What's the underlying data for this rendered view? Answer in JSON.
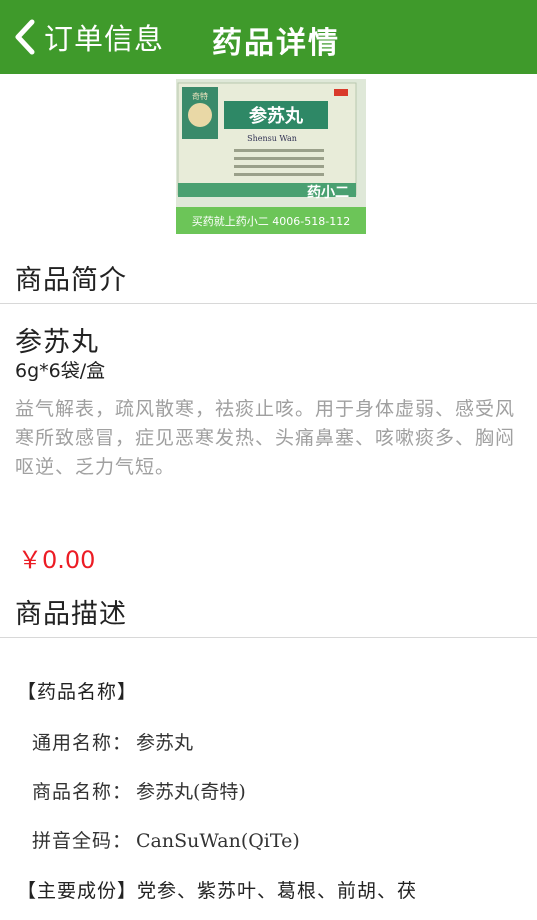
{
  "nav": {
    "back_label": "订单信息",
    "title": "药品详情"
  },
  "product": {
    "box": {
      "brand": "奇特",
      "name": "参苏丸",
      "pinyin": "Shensu Wan",
      "watermark_phone": "买药就上药小二 4006-518-112",
      "watermark_logo": "药小二"
    },
    "intro_section": "商品简介",
    "name": "参苏丸",
    "spec": "6g*6袋/盒",
    "intro": "益气解表，疏风散寒，祛痰止咳。用于身体虚弱、感受风寒所致感冒，症见恶寒发热、头痛鼻塞、咳嗽痰多、胸闷呕逆、乏力气短。",
    "price": "￥0.00"
  },
  "description": {
    "section": "商品描述",
    "heading": "【药品名称】",
    "rows": [
      {
        "key": "通用名称：",
        "value": "参苏丸"
      },
      {
        "key": "商品名称：",
        "value": "参苏丸(奇特)"
      },
      {
        "key": "拼音全码：",
        "value": "CanSuWan(QiTe)"
      }
    ],
    "ingredients_label": "【主要成份】",
    "ingredients_value": "党参、紫苏叶、葛根、前胡、茯"
  },
  "colors": {
    "navbar": "#3f9a2b",
    "price": "#ec1c24",
    "intro_text": "#a0a0a0"
  }
}
